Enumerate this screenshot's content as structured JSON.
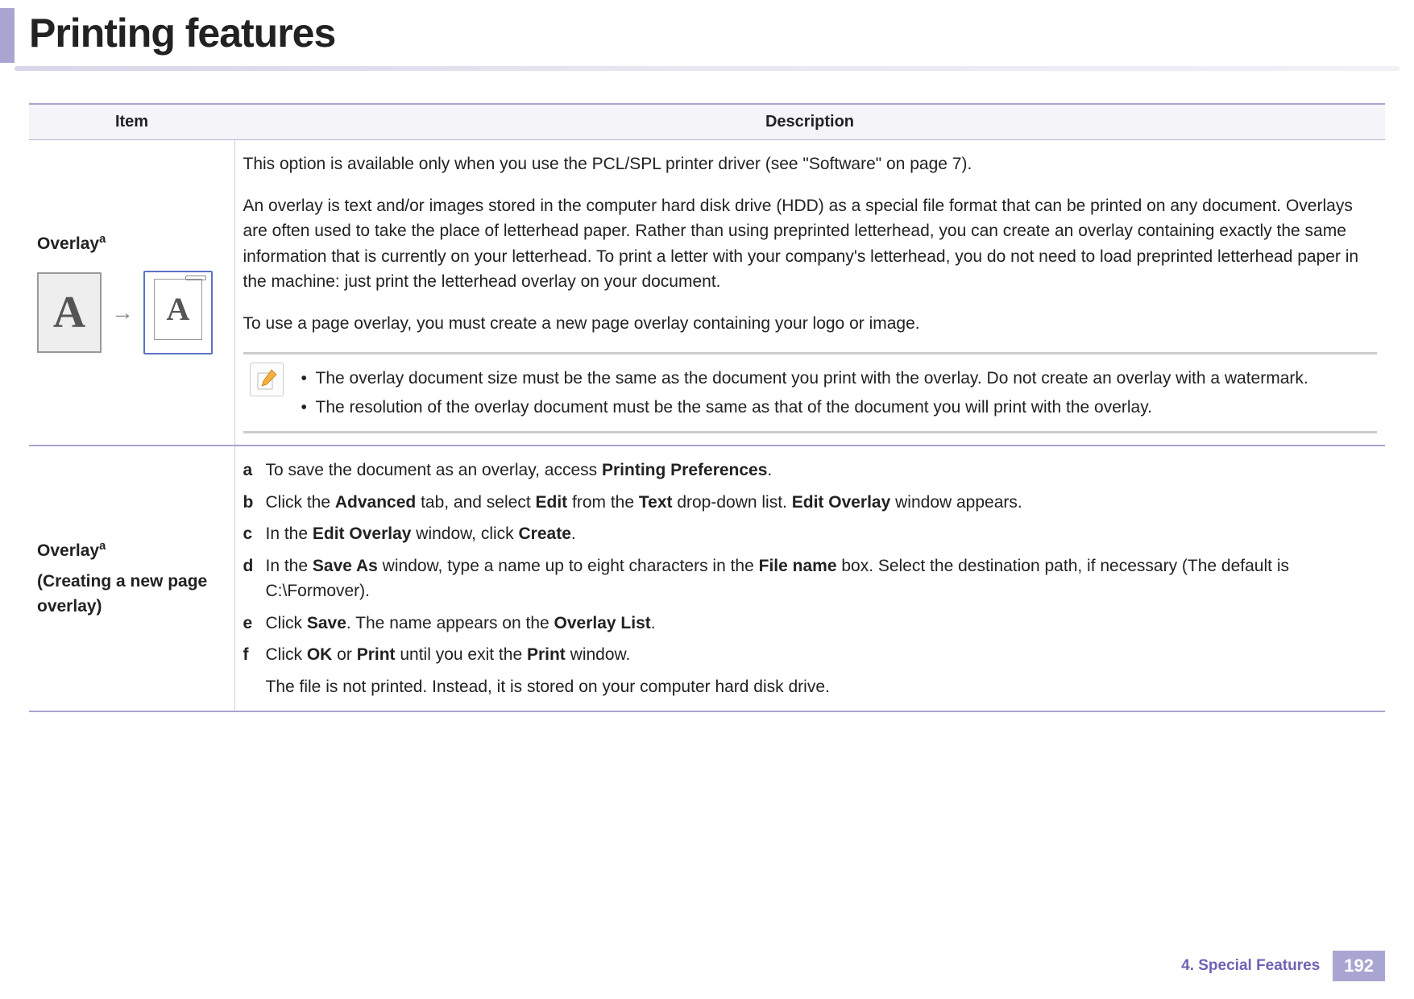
{
  "header": {
    "title": "Printing features"
  },
  "table": {
    "columns": {
      "item": "Item",
      "description": "Description"
    },
    "row1": {
      "item_label": "Overlay",
      "item_sup": "a",
      "p1": "This option is available only when you use the PCL/SPL printer driver (see \"Software\" on page 7).",
      "p2": "An overlay is text and/or images stored in the computer hard disk drive (HDD) as a special file format that can be printed on any document. Overlays are often used to take the place of letterhead paper. Rather than using preprinted letterhead, you can create an overlay containing exactly the same information that is currently on your letterhead. To print a letter with your company's letterhead, you do not need to load preprinted letterhead paper in the machine: just print the letterhead overlay on your document.",
      "p3": "To use a page overlay, you must create a new page overlay containing your logo or image.",
      "note1": "The overlay document size must be the same as the document you print with the overlay. Do not create an overlay with a watermark.",
      "note2": "The resolution of the overlay document must be the same as that of the document you will print with the overlay."
    },
    "row2": {
      "item_label": "Overlay",
      "item_sup": "a",
      "item_sub": "(Creating a new page overlay)",
      "steps": {
        "a": {
          "pre": "To save the document as an overlay, access ",
          "b1": "Printing Preferences",
          "post": "."
        },
        "b": {
          "pre": "Click the ",
          "b1": "Advanced",
          "mid1": " tab, and select ",
          "b2": "Edit",
          "mid2": " from the ",
          "b3": "Text",
          "mid3": " drop-down list. ",
          "b4": "Edit Overlay",
          "post": " window appears."
        },
        "c": {
          "pre": "In the ",
          "b1": "Edit Overlay",
          "mid1": " window, click ",
          "b2": "Create",
          "post": "."
        },
        "d": {
          "pre": "In the ",
          "b1": "Save As",
          "mid1": " window, type a name up to eight characters in the ",
          "b2": "File name",
          "post": " box. Select the destination path, if necessary (The default is C:\\Formover)."
        },
        "e": {
          "pre": "Click ",
          "b1": "Save",
          "mid1": ". The name appears on the ",
          "b2": "Overlay List",
          "post": "."
        },
        "f": {
          "pre": "Click ",
          "b1": "OK",
          "mid1": " or ",
          "b2": "Print",
          "mid2": " until you exit the ",
          "b3": "Print",
          "post": " window."
        },
        "note": "The file is not printed. Instead, it is stored on your computer hard disk drive."
      }
    }
  },
  "footer": {
    "chapter": "4.  Special Features",
    "page": "192"
  }
}
